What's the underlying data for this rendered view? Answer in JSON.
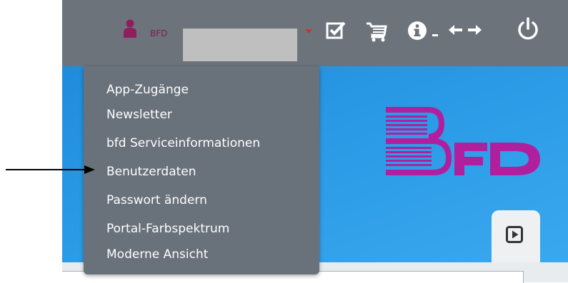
{
  "header": {
    "username": "BFD",
    "icons": [
      "user-icon",
      "checkbox-icon",
      "cart-icon",
      "info-icon",
      "horizontal-arrows-icon",
      "power-icon"
    ]
  },
  "user_menu": {
    "items": [
      "App-Zugänge",
      "Newsletter",
      "bfd Serviceinformationen",
      "Benutzerdaten",
      "Passwort ändern",
      "Portal-Farbspektrum",
      "Moderne Ansicht"
    ]
  },
  "colors": {
    "topbar": "#6c737b",
    "menu_background": "#69717a",
    "hero_blue": "#2a9ae6",
    "logo_magenta": "#b0209e",
    "username": "#7a1f4f"
  }
}
